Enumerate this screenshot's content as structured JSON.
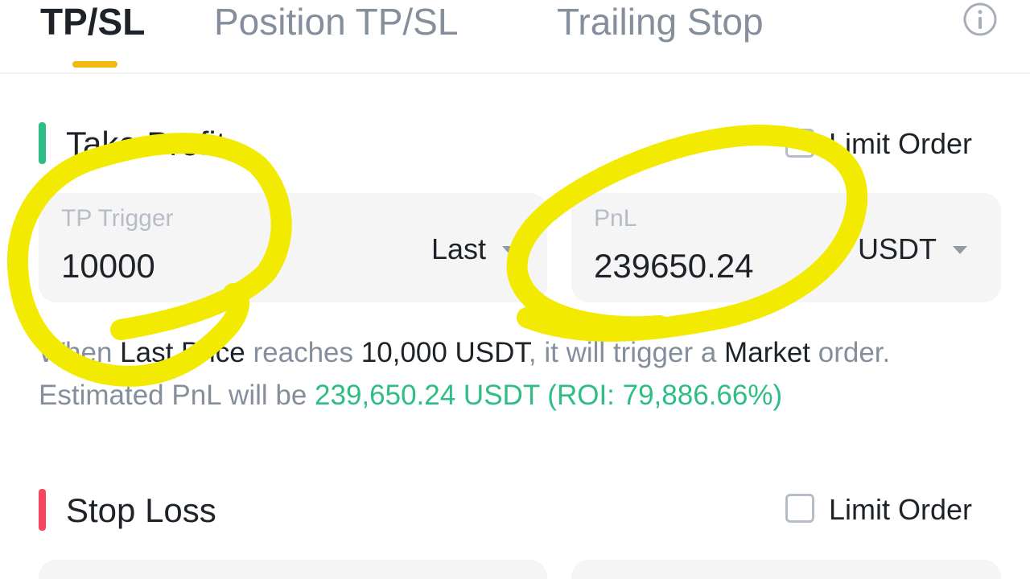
{
  "tabs": [
    {
      "label": "TP/SL",
      "active": true
    },
    {
      "label": "Position TP/SL",
      "active": false
    },
    {
      "label": "Trailing Stop",
      "active": false
    }
  ],
  "info_icon": "info-circle-icon",
  "take_profit": {
    "title": "Take Profit",
    "limit_order_label": "Limit Order",
    "trigger": {
      "label": "TP Trigger",
      "value": "10000",
      "price_type": "Last"
    },
    "pnl": {
      "label": "PnL",
      "value": "239650.24",
      "unit": "USDT"
    },
    "description": {
      "p1": "When ",
      "b1": "Last Price",
      "p2": " reaches ",
      "b2": "10,000 USDT",
      "p3": ", it will trigger a ",
      "b3": "Market",
      "p4": " order. Estimated PnL will be ",
      "g1": "239,650.24 USDT (ROI: 79,886.66%)"
    }
  },
  "stop_loss": {
    "title": "Stop Loss",
    "limit_order_label": "Limit Order"
  },
  "colors": {
    "accent": "#f0b90b",
    "profit_green": "#2ebd85",
    "loss_red": "#f6465d",
    "annotation_yellow": "#f2ea00"
  }
}
